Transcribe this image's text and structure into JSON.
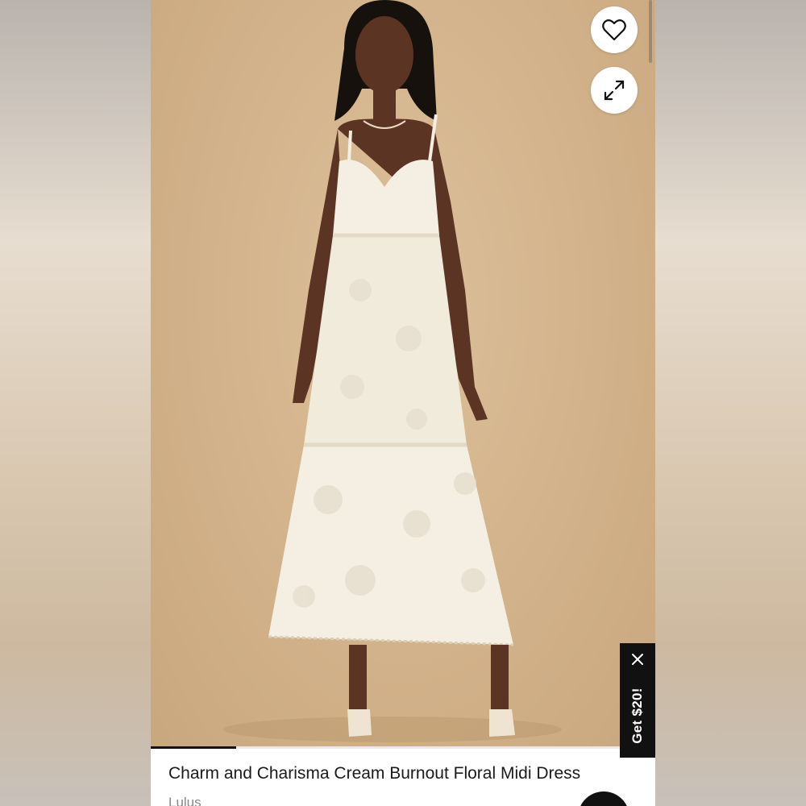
{
  "product": {
    "title": "Charm and Charisma Cream Burnout Floral Midi Dress",
    "brand": "Lulus"
  },
  "gallery": {
    "progress_fraction": 0.17
  },
  "actions": {
    "favorite_icon": "heart-icon",
    "expand_icon": "expand-icon"
  },
  "promo": {
    "label": "Get $20!",
    "close_icon": "close-icon"
  },
  "colors": {
    "photo_background": "#d2b28a",
    "promo_background": "#111111",
    "dress": "#f4efe2"
  }
}
